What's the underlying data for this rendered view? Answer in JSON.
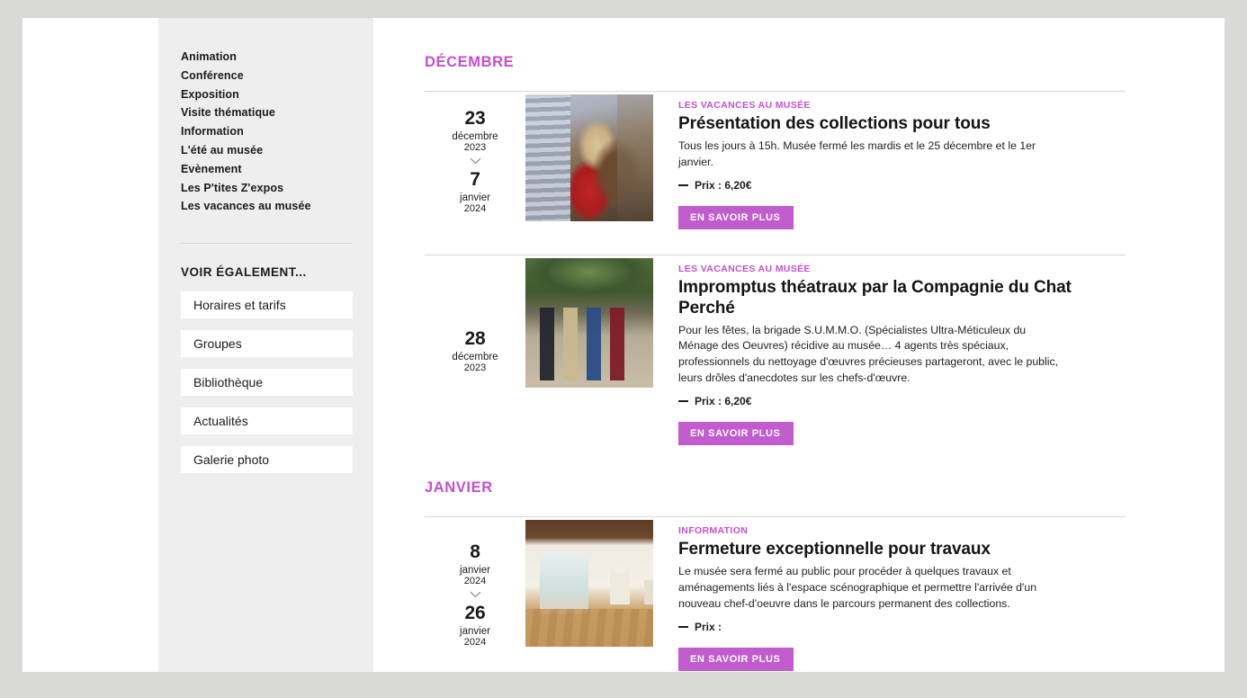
{
  "sidebar": {
    "categories": [
      {
        "label": "Animation"
      },
      {
        "label": "Conférence"
      },
      {
        "label": "Exposition"
      },
      {
        "label": "Visite thématique"
      },
      {
        "label": "Information"
      },
      {
        "label": "L'été au musée"
      },
      {
        "label": "Evènement"
      },
      {
        "label": "Les P'tites Z'expos"
      },
      {
        "label": "Les vacances au musée"
      }
    ],
    "see_also_title": "VOIR ÉGALEMENT...",
    "links": [
      {
        "label": "Horaires et tarifs"
      },
      {
        "label": "Groupes"
      },
      {
        "label": "Bibliothèque"
      },
      {
        "label": "Actualités"
      },
      {
        "label": "Galerie photo"
      }
    ]
  },
  "colors": {
    "accent": "#c44ed0",
    "button": "#c05ccd",
    "sidebar_bg": "#eeeeee",
    "page_bg": "#d9d9d7",
    "text": "#1b1b1b"
  },
  "months": [
    {
      "label": "DÉCEMBRE"
    },
    {
      "label": "JANVIER"
    }
  ],
  "events": [
    {
      "start": {
        "day": "23",
        "month": "décembre",
        "year": "2023"
      },
      "end": {
        "day": "7",
        "month": "janvier",
        "year": "2024"
      },
      "has_range": true,
      "category": "LES VACANCES AU MUSÉE",
      "title": "Présentation des collections pour tous",
      "description": "Tous les jours à 15h. Musée fermé les mardis et le 25 décembre et le 1er janvier.",
      "price_label": "Prix :",
      "price_value": "6,20€",
      "button_label": "EN SAVOIR PLUS",
      "image_alt": "visitors-viewing-exhibit-photo"
    },
    {
      "start": {
        "day": "28",
        "month": "décembre",
        "year": "2023"
      },
      "has_range": false,
      "category": "LES VACANCES AU MUSÉE",
      "title": "Impromptus théatraux par la Compagnie du Chat Perché",
      "description": "Pour les fêtes, la brigade S.U.M.M.O. (Spécialistes Ultra-Méticuleux du Ménage des Oeuvres) récidive au musée… 4 agents très spéciaux, professionnels du nettoyage d'œuvres précieuses partageront, avec le public, leurs drôles d'anecdotes sur les chefs-d'œuvre.",
      "price_label": "Prix :",
      "price_value": "6,20€",
      "button_label": "EN SAVOIR PLUS",
      "image_alt": "theatre-troupe-outdoors-photo"
    },
    {
      "start": {
        "day": "8",
        "month": "janvier",
        "year": "2024"
      },
      "end": {
        "day": "26",
        "month": "janvier",
        "year": "2024"
      },
      "has_range": true,
      "category": "INFORMATION",
      "title": "Fermeture exceptionnelle pour travaux",
      "description": "Le musée sera fermé au public pour procéder à quelques travaux et aménagements liés à l'espace scénographique et permettre l'arrivée d'un nouveau chef-d'oeuvre dans le parcours permanent des collections.",
      "price_label": "Prix :",
      "price_value": "",
      "button_label": "EN SAVOIR PLUS",
      "image_alt": "museum-gallery-interior-photo"
    }
  ]
}
